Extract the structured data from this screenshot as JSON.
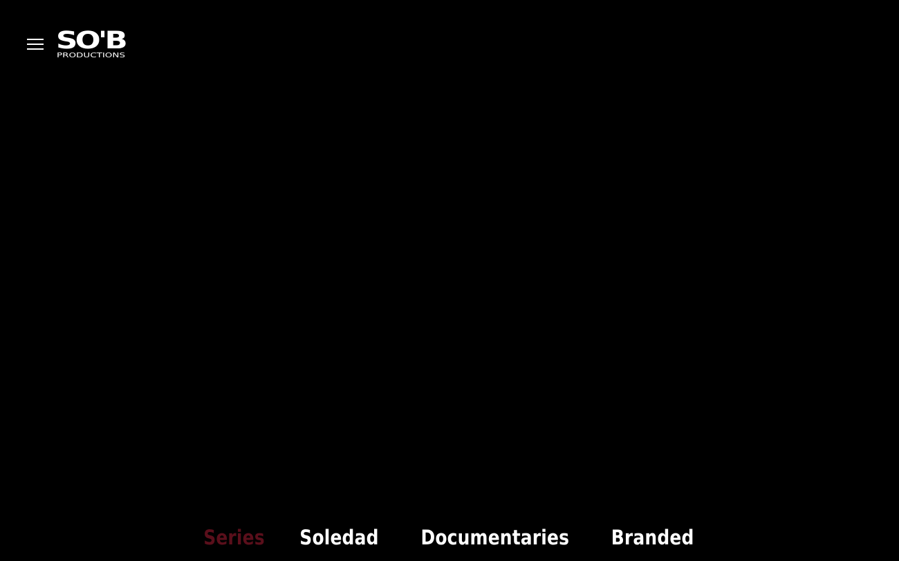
{
  "brand": {
    "logo_main": "SO'B",
    "logo_sub": "PRODUCTIONS",
    "logo_icon": "sob-productions-logo"
  },
  "header": {
    "menu_icon": "hamburger-menu-icon"
  },
  "nav": {
    "items": [
      {
        "label": "Series",
        "active": true
      },
      {
        "label": "Soledad",
        "active": false
      },
      {
        "label": "Documentaries",
        "active": false
      },
      {
        "label": "Branded",
        "active": false
      }
    ]
  },
  "colors": {
    "background": "#000000",
    "text": "#ffffff",
    "active": "#5a0f1b"
  }
}
